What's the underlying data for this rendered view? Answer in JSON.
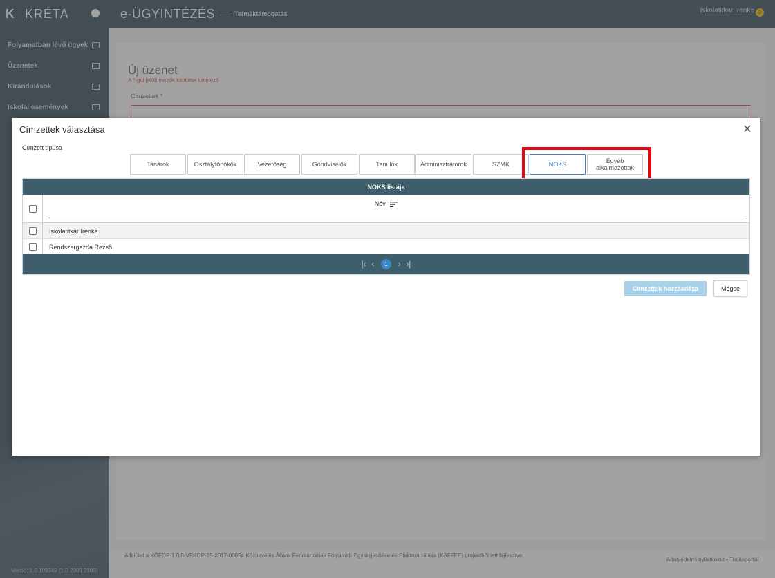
{
  "sidebar": {
    "logo": "KRÉTA",
    "items": [
      {
        "label": "Folyamatban lévő ügyek",
        "icon": "inbox-icon"
      },
      {
        "label": "Üzenetek",
        "icon": "mail-icon"
      },
      {
        "label": "Kirándulások",
        "icon": "bed-icon"
      },
      {
        "label": "Iskolai események",
        "icon": "calendar-icon"
      }
    ],
    "version": "Verzió: 1.0.109349 (1.0.2009.2303)"
  },
  "topbar": {
    "title": "e-ÜGYINTÉZÉS",
    "separator": "—",
    "subtitle": "Terméktámogatás",
    "user": "Iskolatitkar Irenke"
  },
  "page": {
    "title": "Új üzenet",
    "note": "A *-gal jelölt mezők kitöltése kötelező",
    "recipients_label": "Címzettek *"
  },
  "footer": {
    "left": "A felület a KÖFOP-1.0.0-VEKOP-15-2017-00054 Köznevelés Állami Fenntartóinak Folyamat- Egységesítése és Elektronizálása (KAFFEE) projektből lett fejlesztve.",
    "right": "Adatvédelmi nyilatkozat • Tudásportál"
  },
  "modal": {
    "title": "Címzettek választása",
    "type_label": "Címzett típusa",
    "tabs": [
      {
        "label": "Tanárok"
      },
      {
        "label": "Osztályfőnökök"
      },
      {
        "label": "Vezetőség"
      },
      {
        "label": "Gondviselők"
      },
      {
        "label": "Tanulók"
      },
      {
        "label": "Adminisztrátorok"
      },
      {
        "label": "SZMK"
      },
      {
        "label": "NOKS",
        "active": true
      },
      {
        "label": "Egyéb alkalmazottak"
      }
    ],
    "grid": {
      "title": "NOKS listája",
      "column": "Név",
      "rows": [
        "Iskolatitkar Irenke",
        "Rendszergazda Rezső"
      ],
      "current_page": "1"
    },
    "add_button": "Címzettek hozzáadása",
    "cancel_button": "Mégse"
  }
}
